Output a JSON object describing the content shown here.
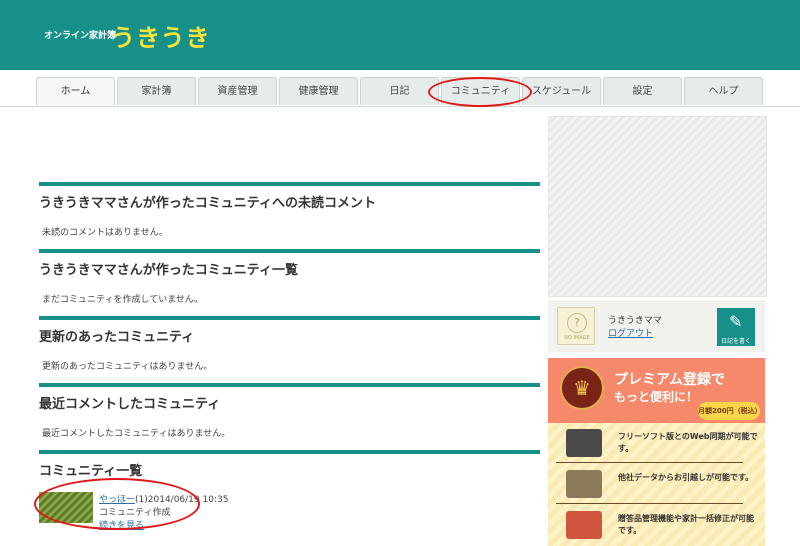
{
  "header": {
    "tagline": "オンライン家計簿",
    "logo": "うきうき"
  },
  "nav": {
    "tabs": [
      "ホーム",
      "家計簿",
      "資産管理",
      "健康管理",
      "日記",
      "コミュニティ",
      "スケジュール",
      "設定",
      "ヘルプ"
    ],
    "active": "コミュニティ"
  },
  "main": {
    "sections": [
      {
        "title": "うきうきママさんが作ったコミュニティへの未読コメント",
        "text": "未読のコメントはありません。"
      },
      {
        "title": "うきうきママさんが作ったコミュニティ一覧",
        "text": "まだコミュニティを作成していません。"
      },
      {
        "title": "更新のあったコミュニティ",
        "text": "更新のあったコミュニティはありません。"
      },
      {
        "title": "最近コメントしたコミュニティ",
        "text": "最近コメントしたコミュニティはありません。"
      }
    ],
    "community_list": {
      "title": "コミュニティ一覧",
      "item": {
        "name": "やっほー",
        "meta": "(1)2014/06/19 10:35",
        "subtitle": "コミュニティ作成",
        "more": "続きを見る"
      }
    }
  },
  "sidebar": {
    "user": {
      "avatar_text": "NO IMAGE",
      "name": "うきうきママ",
      "logout": "ログアウト",
      "diary_button": "日記を書く"
    },
    "premium": {
      "line1": "プレミアム登録で",
      "line2": "もっと便利に！",
      "price": "月額200円（税込）",
      "features": [
        {
          "text": "フリーソフト版とのWeb同期が可能です。",
          "icon": "monitor-icon",
          "color": "#4a4a4a"
        },
        {
          "text": "他社データからお引越しが可能です。",
          "icon": "file-icon",
          "color": "#8a7a5a"
        },
        {
          "text": "贈答品管理機能や家計一括修正が可能です。",
          "icon": "calculator-icon",
          "color": "#d2553f"
        }
      ]
    }
  },
  "colors": {
    "brand": "#17908a",
    "logo": "#f6e43a",
    "annotation": "#e01818",
    "premium": "#f6896b"
  }
}
